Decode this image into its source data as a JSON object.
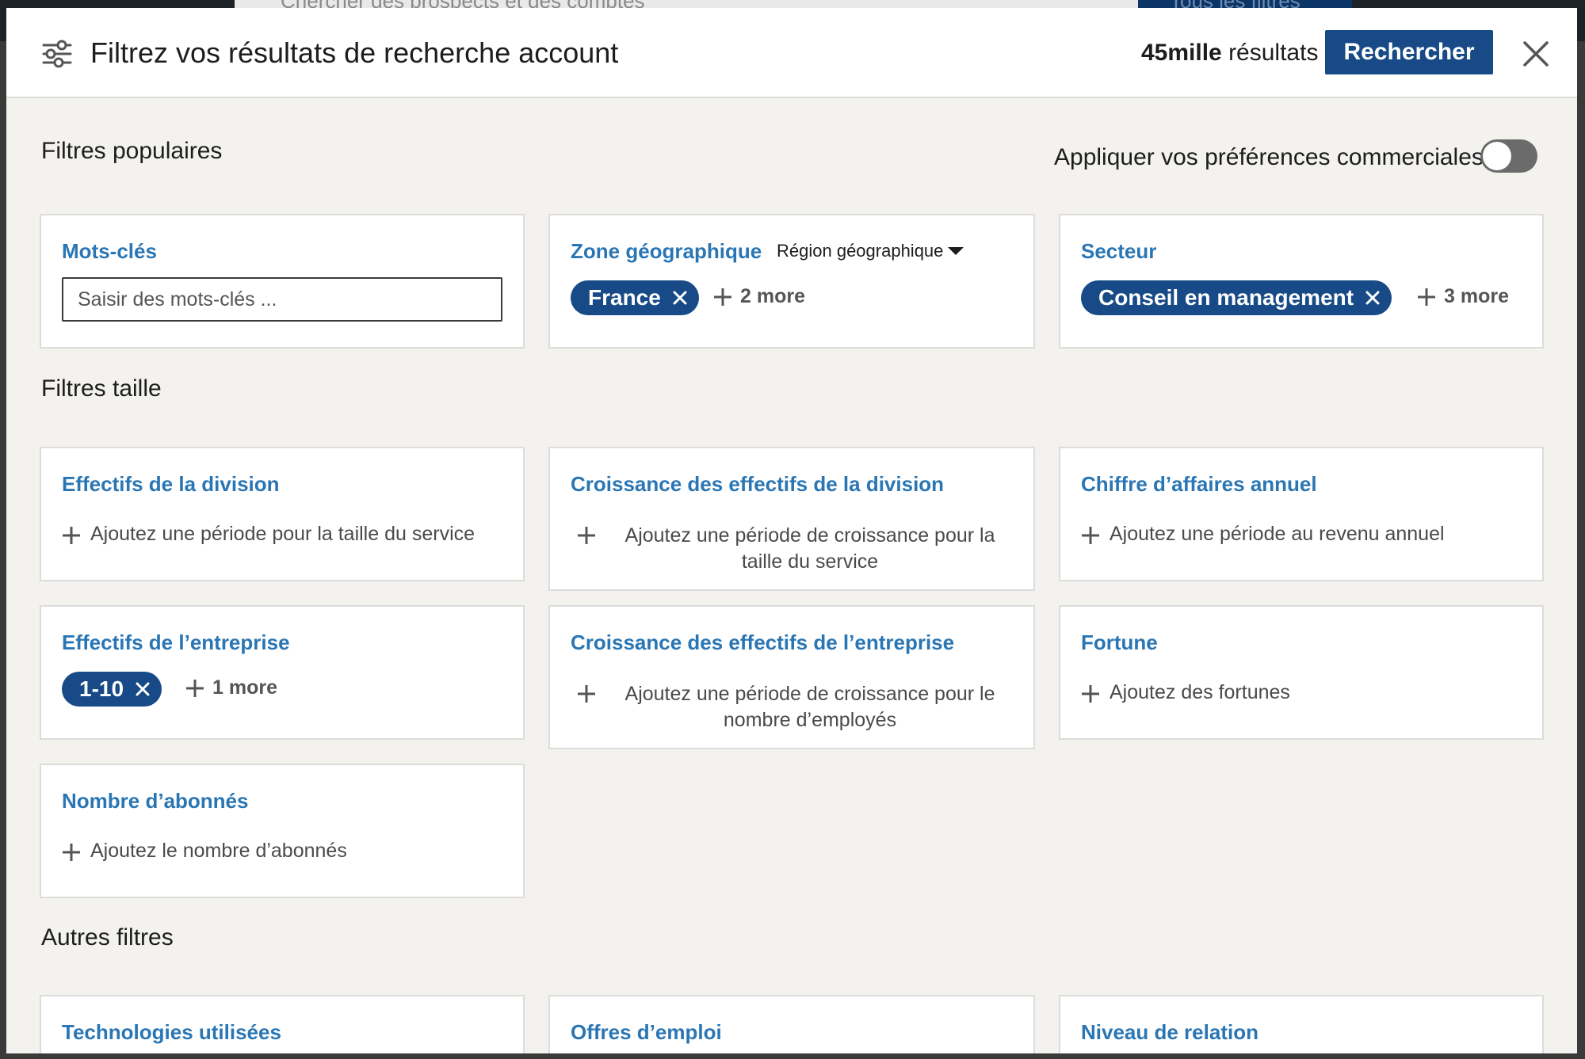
{
  "background": {
    "search_placeholder": "Chercher des prospects et des comptes",
    "all_filters_button": "Tous les filtres"
  },
  "header": {
    "title": "Filtrez vos résultats de recherche account",
    "results_count": "45mille",
    "results_label": " résultats",
    "search_button": "Rechercher"
  },
  "popular": {
    "section_title": "Filtres populaires",
    "preferences_label": "Appliquer vos préférences commerciales",
    "preferences_enabled": false,
    "keywords": {
      "title": "Mots-clés",
      "placeholder": "Saisir des mots-clés ..."
    },
    "geo": {
      "title": "Zone géographique",
      "dropdown": "Région géographique",
      "pill": "France",
      "more": "2 more"
    },
    "sector": {
      "title": "Secteur",
      "pill": "Conseil en management",
      "more": "3 more"
    }
  },
  "size": {
    "section_title": "Filtres taille",
    "division_headcount": {
      "title": "Effectifs de la division",
      "add": "Ajoutez une période pour la taille du service"
    },
    "division_growth": {
      "title": "Croissance des effectifs de la division",
      "add": "Ajoutez une période de croissance pour la taille du service"
    },
    "revenue": {
      "title": "Chiffre d’affaires annuel",
      "add": "Ajoutez une période au revenu annuel"
    },
    "company_headcount": {
      "title": "Effectifs de l’entreprise",
      "pill": "1-10",
      "more": "1 more"
    },
    "company_growth": {
      "title": "Croissance des effectifs de l’entreprise",
      "add": "Ajoutez une période de croissance pour le nombre d’employés"
    },
    "fortune": {
      "title": "Fortune",
      "add": "Ajoutez des fortunes"
    },
    "followers": {
      "title": "Nombre d’abonnés",
      "add": "Ajoutez le nombre d’abonnés"
    }
  },
  "other": {
    "section_title": "Autres filtres",
    "technologies": {
      "title": "Technologies utilisées"
    },
    "jobs": {
      "title": "Offres d’emploi"
    },
    "relation": {
      "title": "Niveau de relation"
    }
  },
  "icons": {
    "filter": "sliders-icon",
    "close": "close-icon",
    "plus": "plus-icon",
    "remove": "x-icon",
    "caret": "caret-down-icon"
  },
  "colors": {
    "accent_link": "#2a76b4",
    "primary_button": "#174a86",
    "toggle_off": "#6b6b6b"
  }
}
